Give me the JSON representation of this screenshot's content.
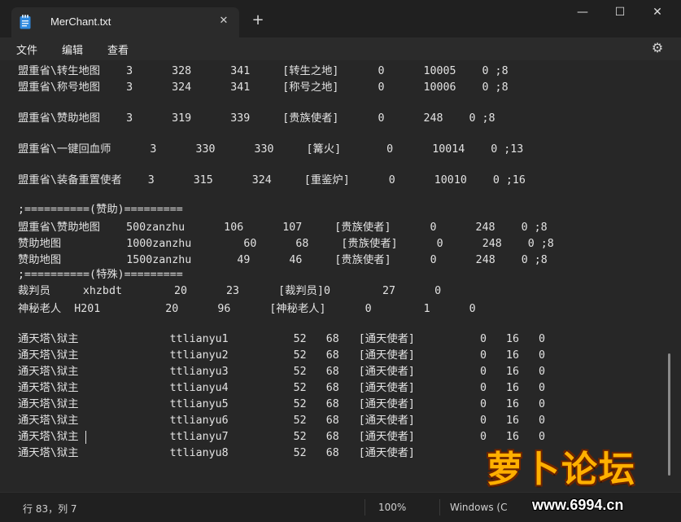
{
  "window": {
    "tab_title": "MerChant.txt",
    "new_tab": "+",
    "tab_close": "✕",
    "minimize": "—",
    "maximize": "☐",
    "close": "✕"
  },
  "menu": {
    "items": [
      "文件",
      "编辑",
      "查看"
    ],
    "settings": "⚙"
  },
  "editor": {
    "lines": [
      "盟重省\\转生地图    3      328      341     [转生之地]      0      10005    0 ;8",
      "盟重省\\称号地图    3      324      341     [称号之地]      0      10006    0 ;8",
      "",
      "盟重省\\赞助地图    3      319      339     [贵族使者]      0      248    0 ;8",
      "",
      "盟重省\\一键回血师      3      330      330     [篝火]       0      10014    0 ;13",
      "",
      "盟重省\\装备重置使者    3      315      324     [重鉴炉]      0      10010    0 ;16",
      "",
      ";==========(赞助)=========",
      "盟重省\\赞助地图    500zanzhu      106      107     [贵族使者]      0      248    0 ;8",
      "赞助地图          1000zanzhu        60      68     [贵族使者]      0      248    0 ;8",
      "赞助地图          1500zanzhu       49      46     [贵族使者]      0      248    0 ;8",
      ";==========(特殊)=========",
      "裁判员     xhzbdt        20      23      [裁判员]0        27      0",
      "神秘老人  H201          20      96      [神秘老人]      0        1      0",
      "",
      "通天塔\\狱主              ttlianyu1          52   68   [通天使者]          0   16   0",
      "通天塔\\狱主              ttlianyu2          52   68   [通天使者]          0   16   0",
      "通天塔\\狱主              ttlianyu3          52   68   [通天使者]          0   16   0",
      "通天塔\\狱主              ttlianyu4          52   68   [通天使者]          0   16   0",
      "通天塔\\狱主              ttlianyu5          52   68   [通天使者]          0   16   0",
      "通天塔\\狱主              ttlianyu6          52   68   [通天使者]          0   16   0",
      "通天塔\\狱主              ttlianyu7          52   68   [通天使者]          0   16   0",
      "通天塔\\狱主              ttlianyu8          52   68   [通天使者]"
    ]
  },
  "status": {
    "position": "行 83，列 7",
    "zoom": "100%",
    "line_ending": "Windows (C"
  },
  "watermark": {
    "logo": "萝卜论坛",
    "url": "www.6994.cn"
  }
}
